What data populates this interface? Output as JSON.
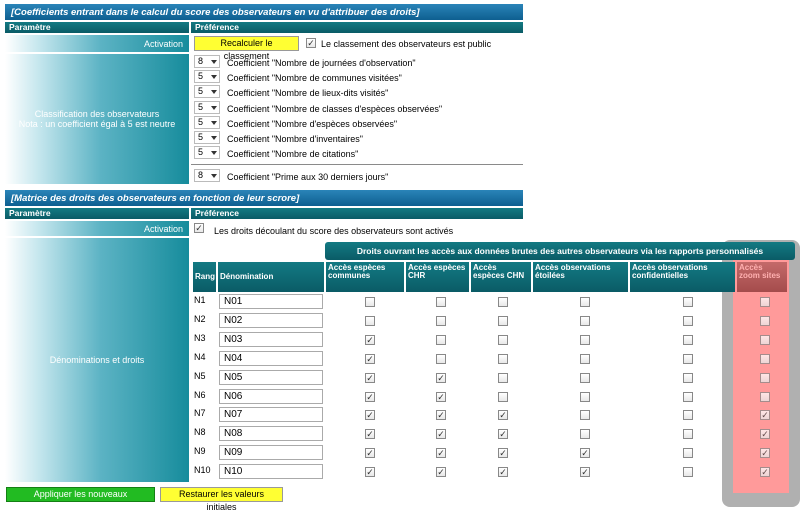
{
  "section1": {
    "title": "[Coefficients entrant dans le calcul du score des observateurs en vu d'attribuer des droits]",
    "col_param": "Paramètre",
    "col_pref": "Préférence",
    "activation_label": "Activation",
    "recalc_button": "Recalculer le classement",
    "public_checked": "✓",
    "public_label": "Le classement des observateurs est public",
    "classification_label_line1": "Classification des observateurs",
    "classification_label_line2": "Nota : un coefficient égal à 5 est neutre",
    "coefficients": [
      {
        "value": "8",
        "label": "Coefficient \"Nombre de journées d'observation\""
      },
      {
        "value": "5",
        "label": "Coefficient \"Nombre de communes visitées\""
      },
      {
        "value": "5",
        "label": "Coefficient \"Nombre de lieux-dits visités\""
      },
      {
        "value": "5",
        "label": "Coefficient \"Nombre de classes d'espèces observées\""
      },
      {
        "value": "5",
        "label": "Coefficient \"Nombre d'espèces observées\""
      },
      {
        "value": "5",
        "label": "Coefficient \"Nombre d'inventaires\""
      },
      {
        "value": "5",
        "label": "Coefficient \"Nombre de citations\""
      }
    ],
    "prime": {
      "value": "8",
      "label": "Coefficient \"Prime aux 30 derniers jours\""
    }
  },
  "section2": {
    "title": "[Matrice des droits des observateurs en fonction de leur scrore]",
    "col_param": "Paramètre",
    "col_pref": "Préférence",
    "activation_label": "Activation",
    "activation_checked": "✓",
    "activation_text": "Les droits découlant du score des observateurs sont activés",
    "denominations_label": "Dénominations et droits",
    "group_header": "Droits ouvrant les accès aux données brutes des autres observateurs via les rapports personnalisés",
    "headers": {
      "rang": "Rang",
      "denomination": "Dénomination",
      "acces_communes": "Accès espèces communes",
      "acces_chr": "Accès espèces CHR",
      "acces_chn": "Accès espèces CHN",
      "acces_etoilees": "Accès observations étoilées",
      "acces_confidentielles": "Accès observations confidentielles",
      "acces_zoom": "Accès zoom sites"
    },
    "check_glyph": "✓",
    "rows": [
      {
        "rank": "N1",
        "name": "N01",
        "rights": [
          false,
          false,
          false,
          false,
          false,
          false
        ]
      },
      {
        "rank": "N2",
        "name": "N02",
        "rights": [
          false,
          false,
          false,
          false,
          false,
          false
        ]
      },
      {
        "rank": "N3",
        "name": "N03",
        "rights": [
          true,
          false,
          false,
          false,
          false,
          false
        ]
      },
      {
        "rank": "N4",
        "name": "N04",
        "rights": [
          true,
          false,
          false,
          false,
          false,
          false
        ]
      },
      {
        "rank": "N5",
        "name": "N05",
        "rights": [
          true,
          true,
          false,
          false,
          false,
          false
        ]
      },
      {
        "rank": "N6",
        "name": "N06",
        "rights": [
          true,
          true,
          false,
          false,
          false,
          false
        ]
      },
      {
        "rank": "N7",
        "name": "N07",
        "rights": [
          true,
          true,
          true,
          false,
          false,
          true
        ]
      },
      {
        "rank": "N8",
        "name": "N08",
        "rights": [
          true,
          true,
          true,
          false,
          false,
          true
        ]
      },
      {
        "rank": "N9",
        "name": "N09",
        "rights": [
          true,
          true,
          true,
          true,
          false,
          true
        ]
      },
      {
        "rank": "N10",
        "name": "N10",
        "rights": [
          true,
          true,
          true,
          true,
          false,
          true
        ]
      }
    ]
  },
  "footer": {
    "apply_button": "Appliquer les nouveaux paramètres",
    "restore_button": "Restaurer les valeurs initiales"
  },
  "colors": {
    "highlight_overlay": "#ff9a9a",
    "highlight_frame": "#b0b0b0"
  }
}
